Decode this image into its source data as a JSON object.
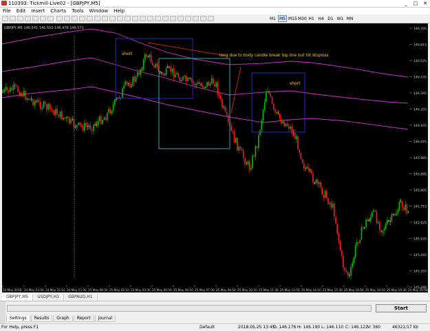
{
  "window": {
    "title": "110393: Tickmill-Live02 - [GBPJPY,M5]",
    "controls": [
      "_",
      "□",
      "✕"
    ]
  },
  "menu": [
    "File",
    "Edit",
    "Insert",
    "Charts",
    "Tools",
    "Window",
    "Help"
  ],
  "timeframes": {
    "items": [
      "M1",
      "M5",
      "M15",
      "M30",
      "H1",
      "H4",
      "D1",
      "W1",
      "MN"
    ],
    "active": "M5"
  },
  "chart": {
    "header": "GBPJPY,M5  146.541 146.550 146.476 146.571",
    "price_labels": [
      "146.705",
      "146.615",
      "146.525",
      "146.435",
      "146.345",
      "146.255",
      "146.165",
      "146.075",
      "145.985",
      "145.895",
      "145.805",
      "145.715",
      "145.625",
      "145.535",
      "145.445",
      "145.355",
      "145.265"
    ],
    "time_labels": [
      "24 May 2018",
      "24 May 23:50",
      "24 May 22:10",
      "24 May 23:30",
      "25 May 00:50",
      "25 May 02:10",
      "25 May 03:30",
      "25 May 04:50",
      "25 May 06:10",
      "25 May 07:30",
      "25 May 08:50",
      "25 May 10:10",
      "25 May 11:30",
      "25 May 12:50",
      "25 May 14:10",
      "25 May 15:30",
      "25 May 16:50",
      "25 May 18:10",
      "25 May 19:30",
      "25 May 20:50"
    ],
    "annotations": {
      "short_1": "short",
      "short_2": "short",
      "long_note": "long due to body candle break top line but hit stoploss"
    },
    "colors": {
      "background": "#000000",
      "bull": "#00c000",
      "bear": "#ff1a1a",
      "doji": "#e6d34a",
      "band": "#d12fd1",
      "box_blue": "#2c2cd6",
      "box_cyan": "#3fbcbc",
      "annotation_text": "#ffd400"
    }
  },
  "symbol_tabs": {
    "items": [
      "GBPJPY,M5",
      "USDJPY,H1",
      "GBPAUD,H1"
    ],
    "active": "GBPJPY,M5"
  },
  "tester": {
    "start_label": "Start",
    "side_label": "Tester",
    "tabs": [
      "Settings",
      "Results",
      "Graph",
      "Report",
      "Journal"
    ],
    "active_tab": "Settings"
  },
  "status": {
    "help": "For Help, press F1",
    "profile": "Default",
    "datetime": "2018.05.25 13:45",
    "open": "O: 146.176",
    "high": "H: 146.190",
    "low": "L: 146.110",
    "close": "C: 146.122",
    "volume": "V: 360",
    "traffic": "46321/17 kb"
  }
}
